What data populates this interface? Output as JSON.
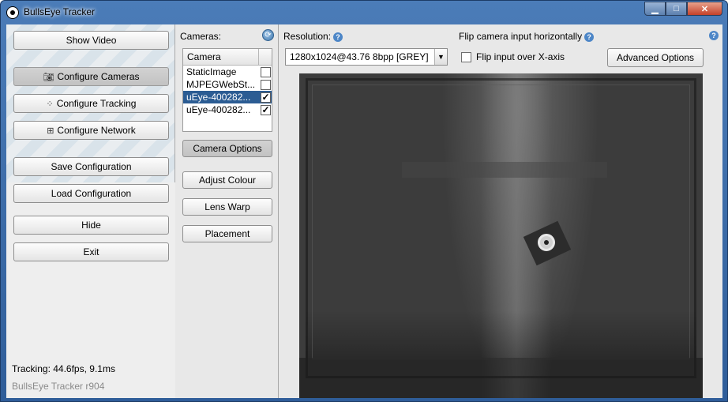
{
  "window": {
    "title": "BullsEye Tracker",
    "controls": {
      "minimize": "▁",
      "maximize": "□",
      "close": "✕"
    }
  },
  "nav": {
    "buttons": [
      {
        "label": "Show Video",
        "icon": ""
      },
      {
        "label": "Configure Cameras",
        "icon": "camera-icon"
      },
      {
        "label": "Configure Tracking",
        "icon": "tracking-icon"
      },
      {
        "label": "Configure Network",
        "icon": "network-icon"
      },
      {
        "label": "Save Configuration",
        "icon": ""
      },
      {
        "label": "Load Configuration",
        "icon": ""
      },
      {
        "label": "Hide",
        "icon": ""
      },
      {
        "label": "Exit",
        "icon": ""
      }
    ],
    "active": "Configure Cameras",
    "status": "Tracking: 44.6fps, 9.1ms",
    "version": "BullsEye Tracker r904"
  },
  "cameras": {
    "label": "Cameras:",
    "column_header": "Camera",
    "list": [
      {
        "name": "StaticImage",
        "checked": false,
        "selected": false
      },
      {
        "name": "MJPEGWebSt...",
        "checked": false,
        "selected": false
      },
      {
        "name": "uEye-400282...",
        "checked": true,
        "selected": true
      },
      {
        "name": "uEye-400282...",
        "checked": true,
        "selected": false
      }
    ],
    "buttons": {
      "camera_options": "Camera Options",
      "adjust_colour": "Adjust Colour",
      "lens_warp": "Lens Warp",
      "placement": "Placement"
    }
  },
  "settings": {
    "resolution_label": "Resolution:",
    "resolution_value": "1280x1024@43.76 8bpp [GREY]",
    "flip_label": "Flip camera input horizontally",
    "flip_x_label": "Flip input over X-axis",
    "flip_x_checked": false,
    "advanced_button": "Advanced Options",
    "help_glyph": "?"
  },
  "colors": {
    "selection": "#2b5c93",
    "help_icon": "#4d86c7",
    "title_bar": "#4b7cb8"
  }
}
